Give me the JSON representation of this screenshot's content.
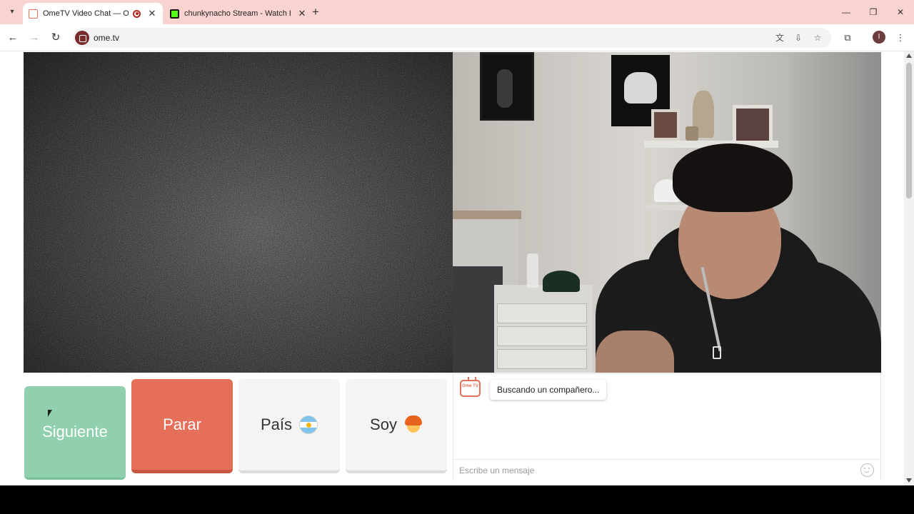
{
  "browser": {
    "tabs": [
      {
        "title": "OmeTV Video Chat — Ome",
        "active": true,
        "favicon_color": "#e66f59",
        "recording": true
      },
      {
        "title": "chunkynacho Stream - Watch Li",
        "active": false,
        "favicon_color": "#53fc18"
      }
    ],
    "url": "ome.tv",
    "icons": [
      "tab-search-icon",
      "new-tab-icon",
      "minimize-icon",
      "restore-icon",
      "close-window-icon",
      "back-icon",
      "forward-icon",
      "reload-icon",
      "translate-icon",
      "install-app-icon",
      "bookmark-star-icon",
      "extensions-icon",
      "profile-icon",
      "menu-icon"
    ],
    "profile_initial": "I"
  },
  "controls": {
    "next_label": "Siguiente",
    "stop_label": "Parar",
    "country_label": "País",
    "gender_label": "Soy",
    "next_color": "#90d0ae",
    "stop_color": "#e66f59"
  },
  "chat": {
    "logo_text": "Ome TV",
    "status": "Buscando un compañero...",
    "input_placeholder": "Escribe un mensaje"
  }
}
